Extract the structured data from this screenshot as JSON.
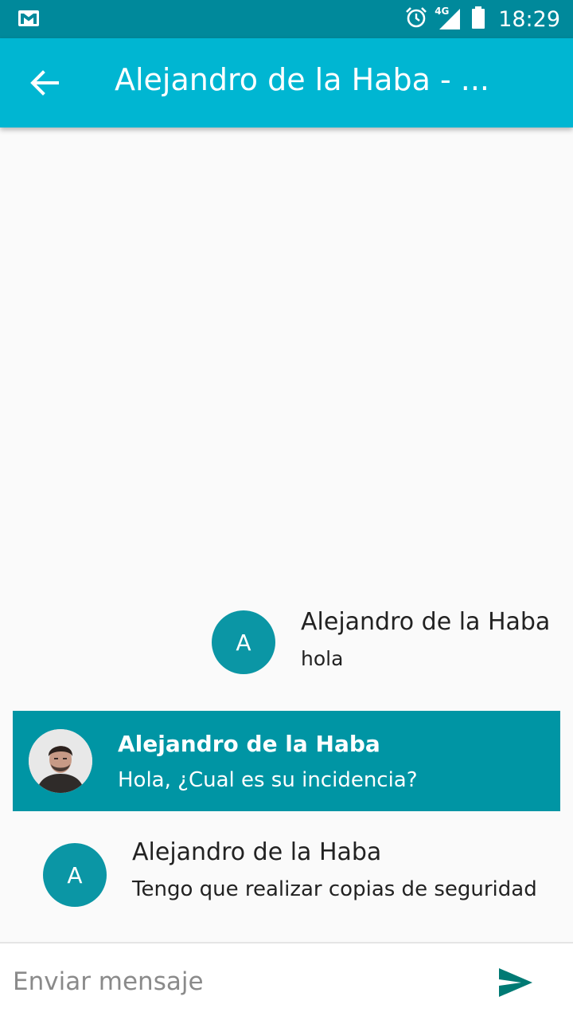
{
  "status_bar": {
    "time": "18:29",
    "network": "4G",
    "icons": [
      "gmail-icon",
      "alarm-icon",
      "signal-icon",
      "battery-icon"
    ]
  },
  "app_bar": {
    "title": "Alejandro de la Haba - ...",
    "back_icon": "arrow-back-icon"
  },
  "messages": [
    {
      "sender": "Alejandro de la Haba",
      "text": "hola",
      "avatar_letter": "A"
    },
    {
      "sender": "Alejandro de la Haba",
      "text": "Hola, ¿Cual es su incidencia?",
      "highlighted": true,
      "avatar": "photo"
    },
    {
      "sender": "Alejandro de la Haba",
      "text": "Tengo que realizar copias de seguridad",
      "avatar_letter": "A"
    }
  ],
  "composer": {
    "placeholder": "Enviar mensaje",
    "value": "",
    "send_icon": "send-icon"
  },
  "colors": {
    "status_bar": "#00899b",
    "app_bar": "#00b6d2",
    "highlight_message": "#0095a4",
    "avatar": "#0b96a5",
    "send_icon": "#007a74"
  }
}
